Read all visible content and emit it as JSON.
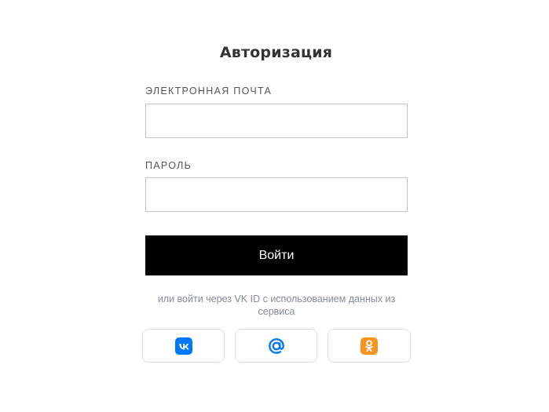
{
  "form": {
    "title": "Авторизация",
    "email_label": "ЭЛЕКТРОННАЯ ПОЧТА",
    "email_value": "",
    "email_placeholder": "",
    "password_label": "ПАРОЛЬ",
    "password_value": "",
    "password_placeholder": "",
    "submit_label": "Войти"
  },
  "vk_id": {
    "hint": "или войти через VK ID с использованием данных из сервиса",
    "providers": [
      {
        "name": "vk-icon",
        "color": "#0077ff"
      },
      {
        "name": "mail-at-icon",
        "color": "#0077ff"
      },
      {
        "name": "odnoklassniki-icon",
        "color": "#f7931e"
      }
    ]
  },
  "colors": {
    "button_bg": "#000000",
    "button_text": "#ffffff",
    "hint_text": "#818c99",
    "vk_blue": "#0077ff",
    "ok_orange": "#f7931e"
  }
}
